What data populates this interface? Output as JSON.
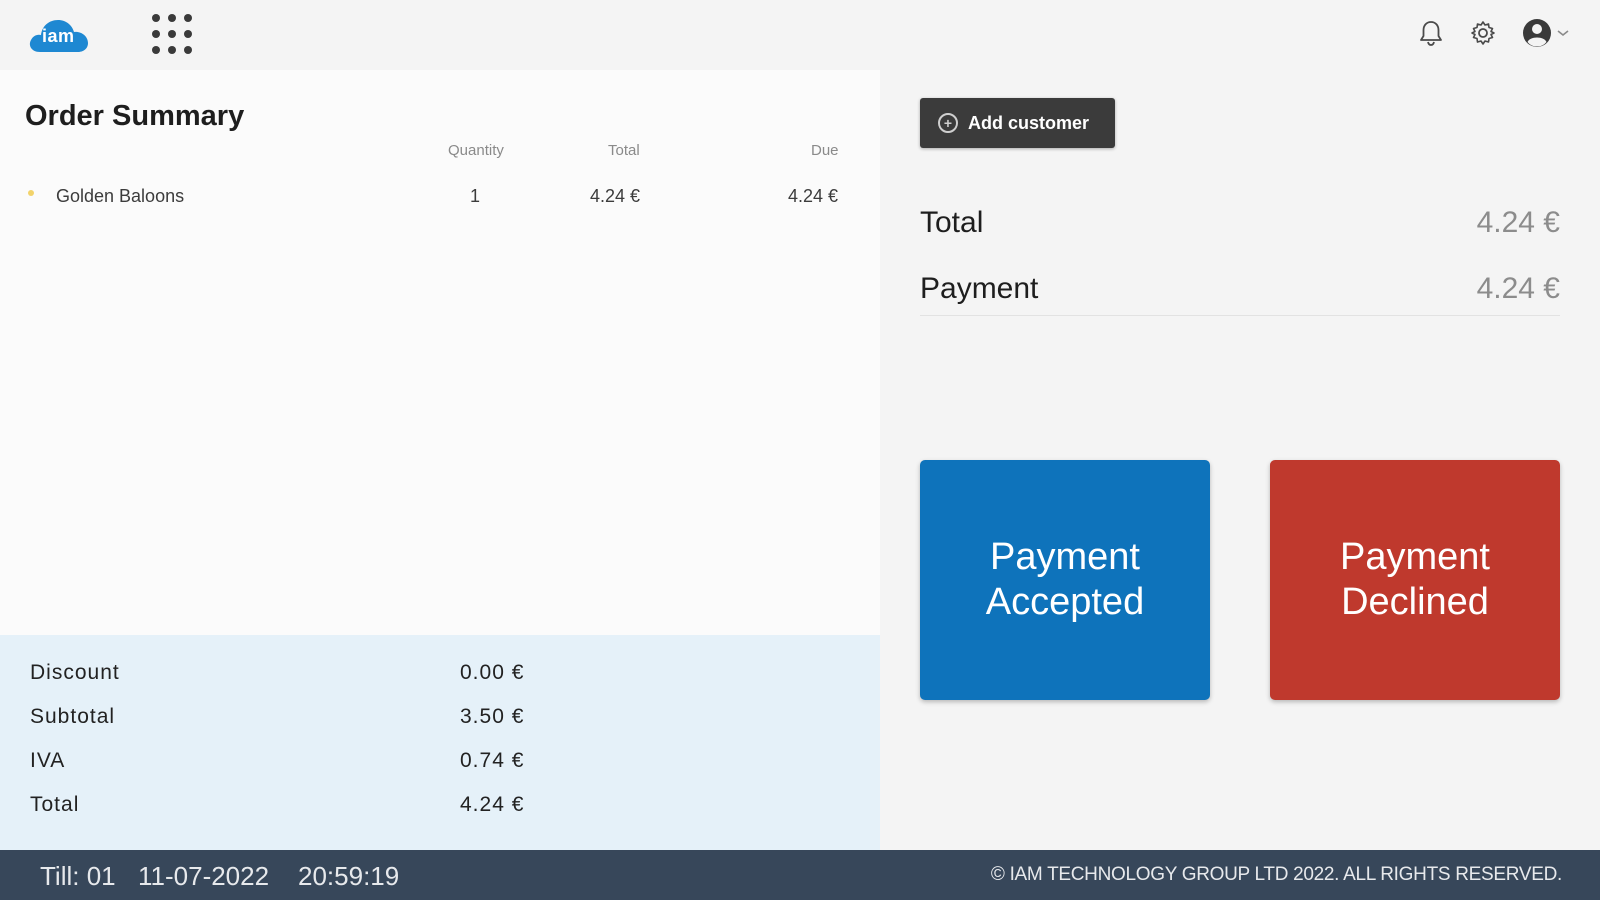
{
  "header": {
    "logo_text": "iam",
    "apps_icon": "apps-grid-icon",
    "icons": [
      "bell-icon",
      "gear-icon",
      "user-avatar-icon",
      "chevron-down-icon"
    ]
  },
  "order": {
    "title": "Order Summary",
    "columns": {
      "quantity": "Quantity",
      "total": "Total",
      "due": "Due"
    },
    "items": [
      {
        "name": "Golden Baloons",
        "quantity": "1",
        "total": "4.24 €",
        "due": "4.24 €"
      }
    ]
  },
  "summary": {
    "rows": [
      {
        "label": "Discount",
        "value": "0.00 €"
      },
      {
        "label": "Subtotal",
        "value": "3.50 €"
      },
      {
        "label": "IVA",
        "value": "0.74 €"
      },
      {
        "label": "Total",
        "value": "4.24 €"
      }
    ]
  },
  "payment_panel": {
    "add_customer_label": "Add customer",
    "total_label": "Total",
    "total_value": "4.24 €",
    "payment_label": "Payment",
    "payment_value": "4.24 €",
    "accept_label_line1": "Payment",
    "accept_label_line2": "Accepted",
    "decline_label_line1": "Payment",
    "decline_label_line2": "Declined"
  },
  "footer": {
    "till": "Till: 01",
    "date": "11-07-2022",
    "time": "20:59:19",
    "copyright": "© IAM TECHNOLOGY GROUP LTD 2022. ALL RIGHTS RESERVED."
  },
  "colors": {
    "accept": "#0e73bb",
    "decline": "#bf392d",
    "footer": "#37475a",
    "summary_bg": "#e5f1f9"
  }
}
